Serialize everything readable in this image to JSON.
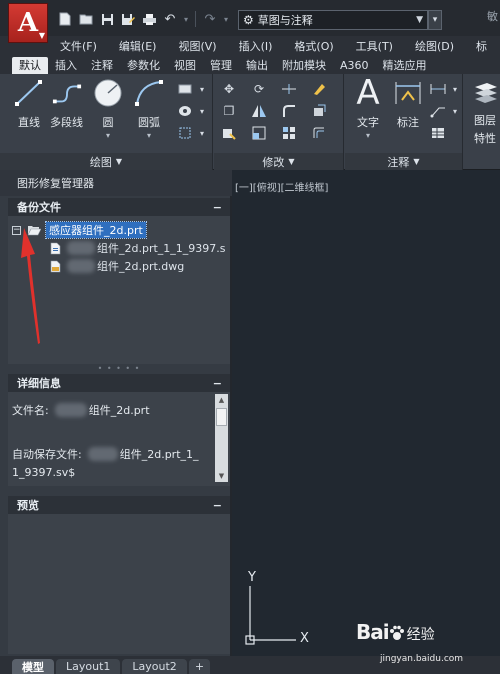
{
  "app": {
    "logo": "A"
  },
  "quick_access": {
    "icons": [
      "new-icon",
      "open-icon",
      "save-icon",
      "save-as-icon",
      "print-icon",
      "undo-icon",
      "redo-icon"
    ],
    "workspace": "草图与注释"
  },
  "title_char": "敏",
  "menu": [
    "文件(F)",
    "编辑(E)",
    "视图(V)",
    "插入(I)",
    "格式(O)",
    "工具(T)",
    "绘图(D)",
    "标"
  ],
  "ribbon_tabs": [
    {
      "label": "默认",
      "active": true
    },
    {
      "label": "插入"
    },
    {
      "label": "注释"
    },
    {
      "label": "参数化"
    },
    {
      "label": "视图"
    },
    {
      "label": "管理"
    },
    {
      "label": "输出"
    },
    {
      "label": "附加模块"
    },
    {
      "label": "A360"
    },
    {
      "label": "精选应用"
    }
  ],
  "ribbon": {
    "draw": {
      "footer": "绘图",
      "line": "直线",
      "polyline": "多段线",
      "circle": "圆",
      "arc": "圆弧"
    },
    "modify": {
      "footer": "修改"
    },
    "annotation": {
      "footer": "注释",
      "text": "文字",
      "dimension": "标注"
    },
    "layers": {
      "label_1": "图层",
      "label_2": "特性"
    }
  },
  "palette": {
    "title": "图形修复管理器",
    "backup": {
      "header": "备份文件",
      "root": "感应器组件_2d.prt",
      "children": [
        "组件_2d.prt_1_1_9397.s",
        "组件_2d.prt.dwg"
      ]
    },
    "details": {
      "header": "详细信息",
      "file_label": "文件名:",
      "file_value": "组件_2d.prt",
      "autosave_label": "自动保存文件:",
      "autosave_value_1": "组件_2d.prt_1_",
      "autosave_value_2": "1_9397.sv$"
    },
    "preview": {
      "header": "预览"
    }
  },
  "canvas": {
    "viewport_label": "[一][俯视][二维线框]",
    "ucs_x": "X",
    "ucs_y": "Y"
  },
  "layout_tabs": [
    {
      "label": "模型",
      "active": true
    },
    {
      "label": "Layout1"
    },
    {
      "label": "Layout2"
    }
  ],
  "watermark": {
    "logo": "Bai",
    "logo_mid": "经验",
    "url": "jingyan.baidu.com"
  },
  "colors": {
    "accent_red": "#c0302a",
    "selection_blue": "#2f6fbf",
    "annotation_arrow": "#e0312c"
  }
}
